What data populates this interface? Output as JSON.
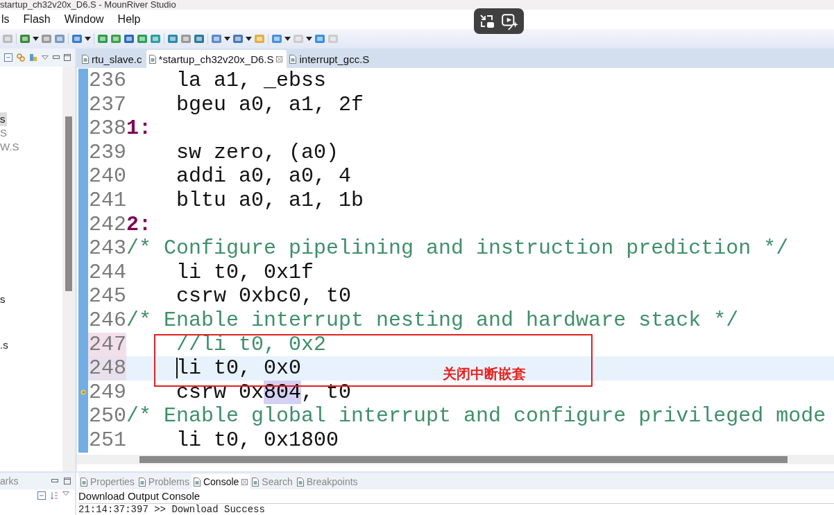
{
  "window": {
    "title": "startup_ch32v20x_D6.S - MounRiver Studio"
  },
  "menu": [
    "ls",
    "Flash",
    "Window",
    "Help"
  ],
  "left_panel": {
    "items": [
      {
        "label": "s",
        "selected": true,
        "dimmed": false
      },
      {
        "label": "S",
        "selected": false,
        "dimmed": true
      },
      {
        "label": "W.S",
        "selected": false,
        "dimmed": true
      },
      {
        "label": "s",
        "selected": false,
        "dimmed": false
      },
      {
        "label": ".s",
        "selected": false,
        "dimmed": false
      }
    ]
  },
  "editor": {
    "tabs": [
      {
        "label": "rtu_slave.c",
        "selected": false,
        "closable": false
      },
      {
        "label": "*startup_ch32v20x_D6.S",
        "selected": true,
        "closable": true
      },
      {
        "label": "interrupt_gcc.S",
        "selected": false,
        "closable": false
      }
    ],
    "lines": [
      {
        "number": "236",
        "current": false,
        "modified": false,
        "pointer": false,
        "segments": [
          {
            "kind": "code",
            "text": "    la a1, _ebss"
          }
        ]
      },
      {
        "number": "237",
        "current": false,
        "modified": false,
        "pointer": false,
        "segments": [
          {
            "kind": "code",
            "text": "    bgeu a0, a1, 2f"
          }
        ]
      },
      {
        "number": "238",
        "current": false,
        "modified": false,
        "pointer": false,
        "segments": [
          {
            "kind": "label",
            "text": "1:"
          }
        ]
      },
      {
        "number": "239",
        "current": false,
        "modified": false,
        "pointer": false,
        "segments": [
          {
            "kind": "code",
            "text": "    sw zero, (a0)"
          }
        ]
      },
      {
        "number": "240",
        "current": false,
        "modified": false,
        "pointer": false,
        "segments": [
          {
            "kind": "code",
            "text": "    addi a0, a0, 4"
          }
        ]
      },
      {
        "number": "241",
        "current": false,
        "modified": false,
        "pointer": false,
        "segments": [
          {
            "kind": "code",
            "text": "    bltu a0, a1, 1b"
          }
        ]
      },
      {
        "number": "242",
        "current": false,
        "modified": false,
        "pointer": false,
        "segments": [
          {
            "kind": "label",
            "text": "2:"
          }
        ]
      },
      {
        "number": "243",
        "current": false,
        "modified": false,
        "pointer": false,
        "segments": [
          {
            "kind": "comment",
            "text": "/* Configure pipelining and instruction prediction */"
          }
        ]
      },
      {
        "number": "244",
        "current": false,
        "modified": false,
        "pointer": false,
        "segments": [
          {
            "kind": "code",
            "text": "    li t0, 0x1f"
          }
        ]
      },
      {
        "number": "245",
        "current": false,
        "modified": false,
        "pointer": false,
        "segments": [
          {
            "kind": "code",
            "text": "    csrw 0xbc0, t0"
          }
        ]
      },
      {
        "number": "246",
        "current": false,
        "modified": false,
        "pointer": false,
        "segments": [
          {
            "kind": "comment",
            "text": "/* Enable interrupt nesting and hardware stack */"
          }
        ]
      },
      {
        "number": "247",
        "current": false,
        "modified": true,
        "pointer": false,
        "segments": [
          {
            "kind": "comment",
            "text": "    //li t0, 0x2"
          }
        ]
      },
      {
        "number": "248",
        "current": true,
        "modified": true,
        "pointer": false,
        "segments": [
          {
            "kind": "code",
            "text": "    li t0, 0x0"
          }
        ]
      },
      {
        "number": "249",
        "current": false,
        "modified": false,
        "pointer": true,
        "segments": [
          {
            "kind": "code",
            "text": "    csrw 0x"
          },
          {
            "kind": "match",
            "text": "804"
          },
          {
            "kind": "code",
            "text": ", t0"
          }
        ]
      },
      {
        "number": "250",
        "current": false,
        "modified": false,
        "pointer": false,
        "segments": [
          {
            "kind": "comment",
            "text": "/* Enable global interrupt and configure privileged mode"
          }
        ]
      },
      {
        "number": "251",
        "current": false,
        "modified": false,
        "pointer": false,
        "segments": [
          {
            "kind": "code",
            "text": "    li t0, 0x1800"
          }
        ]
      }
    ],
    "annotation": {
      "text": "关闭中断嵌套"
    }
  },
  "bottom_left": {
    "title": "arks"
  },
  "bottom_panel": {
    "tabs": [
      {
        "label": "Properties",
        "selected": false,
        "closable": false
      },
      {
        "label": "Problems",
        "selected": false,
        "closable": false
      },
      {
        "label": "Console",
        "selected": true,
        "closable": true
      },
      {
        "label": "Search",
        "selected": false,
        "closable": false
      },
      {
        "label": "Breakpoints",
        "selected": false,
        "closable": false
      }
    ],
    "console_title": "Download Output Console",
    "output": [
      "21:14:37:397 >> Download Success"
    ]
  }
}
